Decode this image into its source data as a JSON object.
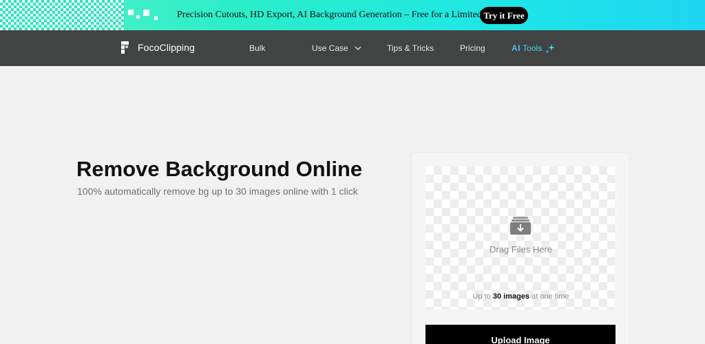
{
  "promo": {
    "text": "Precision Cutouts, HD Export, AI Background Generation – Free for a Limited Time",
    "cta_label": "Try it Free"
  },
  "nav": {
    "logo_text": "FocoClipping",
    "items": [
      {
        "label": "Bulk"
      },
      {
        "label": "Use Case"
      },
      {
        "label": "Tips & Tricks"
      },
      {
        "label": "Pricing"
      }
    ],
    "ai_tools": {
      "prefix": "AI",
      "label": "Tools"
    }
  },
  "hero": {
    "title": "Remove Background Online",
    "subtitle": "100% automatically remove bg up to 30 images online with 1 click"
  },
  "upload": {
    "drag_text": "Drag Files Here",
    "limit_prefix": "Up to",
    "limit_value": "30 images",
    "limit_suffix": "at one time",
    "button_label": "Upload Image"
  },
  "colors": {
    "promo_gradient_start": "#55f0c8",
    "promo_gradient_end": "#1fd6f2",
    "nav_bg": "#424343",
    "ai_gradient_start": "#4cb6ff",
    "ai_gradient_end": "#3ee7e0",
    "page_bg": "#f0f1f0",
    "button_bg": "#000000"
  },
  "icons": {
    "logo": "foco-logo-icon",
    "use_case_chevron": "chevron-down-icon",
    "ai_sparkle": "sparkle-icon",
    "upload_folder": "folder-download-icon"
  }
}
